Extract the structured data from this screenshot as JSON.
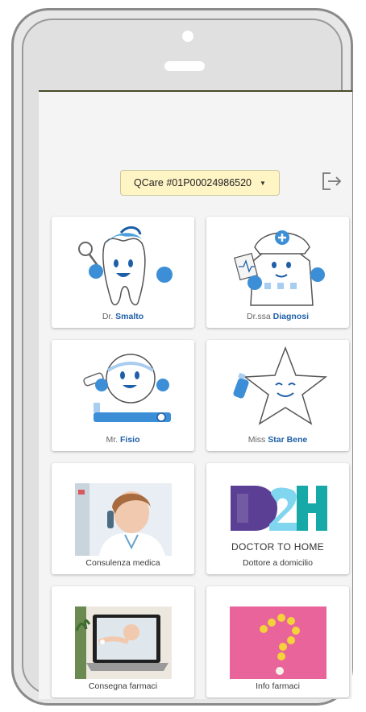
{
  "header": {
    "account_selector": "QCare #01P00024986520",
    "logout_icon": "logout-icon"
  },
  "tiles": [
    {
      "id": "smalto",
      "prefix": "Dr.",
      "name": "Smalto",
      "icon": "tooth-character"
    },
    {
      "id": "diagnosi",
      "prefix": "Dr.ssa",
      "name": "Diagnosi",
      "icon": "hospital-character"
    },
    {
      "id": "fisio",
      "prefix": "Mr.",
      "name": "Fisio",
      "icon": "ball-character"
    },
    {
      "id": "star-bene",
      "prefix": "Miss",
      "name": "Star Bene",
      "icon": "star-character"
    },
    {
      "id": "consulenza",
      "label": "Consulenza medica",
      "icon": "doctor-phone-photo"
    },
    {
      "id": "d2h",
      "label": "Dottore a domicilio",
      "brand": "DOCTOR TO HOME",
      "logo_text": "D2H",
      "icon": "d2h-logo"
    },
    {
      "id": "consegna",
      "label": "Consegna farmaci",
      "icon": "laptop-pills-photo"
    },
    {
      "id": "info",
      "label": "Info farmaci",
      "icon": "question-mark-pills-photo"
    }
  ],
  "colors": {
    "select_bg": "#fff4c4",
    "character_blue": "#1e5fa8",
    "d2h_purple": "#5b3f95",
    "d2h_teal": "#16a9a7",
    "info_pink": "#e8649a"
  }
}
